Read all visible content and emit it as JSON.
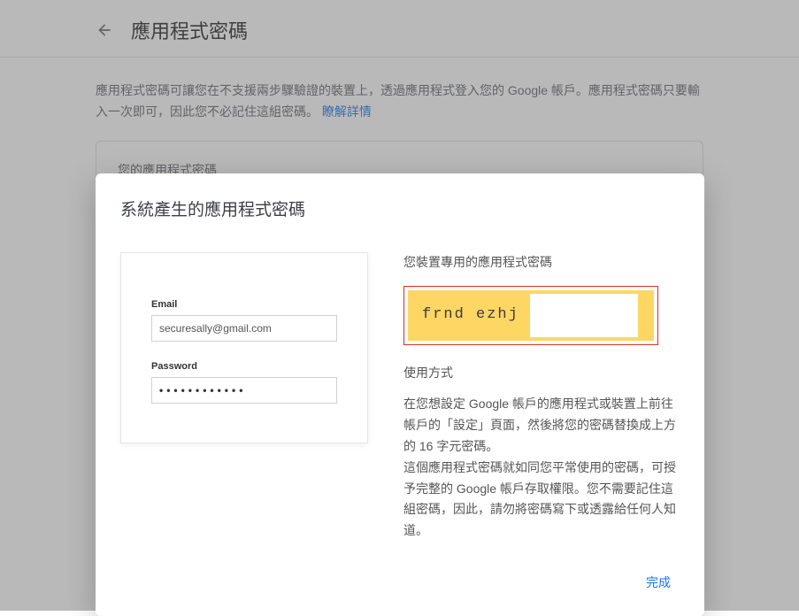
{
  "header": {
    "title": "應用程式密碼"
  },
  "description": {
    "text": "應用程式密碼可讓您在不支援兩步驟驗證的裝置上，透過應用程式登入您的 Google 帳戶。應用程式密碼只要輸入一次即可，因此您不必記住這組密碼。",
    "link": "瞭解詳情"
  },
  "card": {
    "title": "您的應用程式密碼"
  },
  "modal": {
    "title": "系統產生的應用程式密碼",
    "login": {
      "emailLabel": "Email",
      "emailValue": "securesally@gmail.com",
      "passwordLabel": "Password",
      "passwordValue": "••••••••••••"
    },
    "right": {
      "heading": "您裝置專用的應用程式密碼",
      "generatedPassword": "frnd ezhj",
      "usageHeading": "使用方式",
      "usageText": "在您想設定 Google 帳戶的應用程式或裝置上前往帳戶的「設定」頁面，然後將您的密碼替換成上方的 16 字元密碼。\n這個應用程式密碼就如同您平常使用的密碼，可授予完整的 Google 帳戶存取權限。您不需要記住這組密碼，因此，請勿將密碼寫下或透露給任何人知道。"
    },
    "done": "完成"
  }
}
